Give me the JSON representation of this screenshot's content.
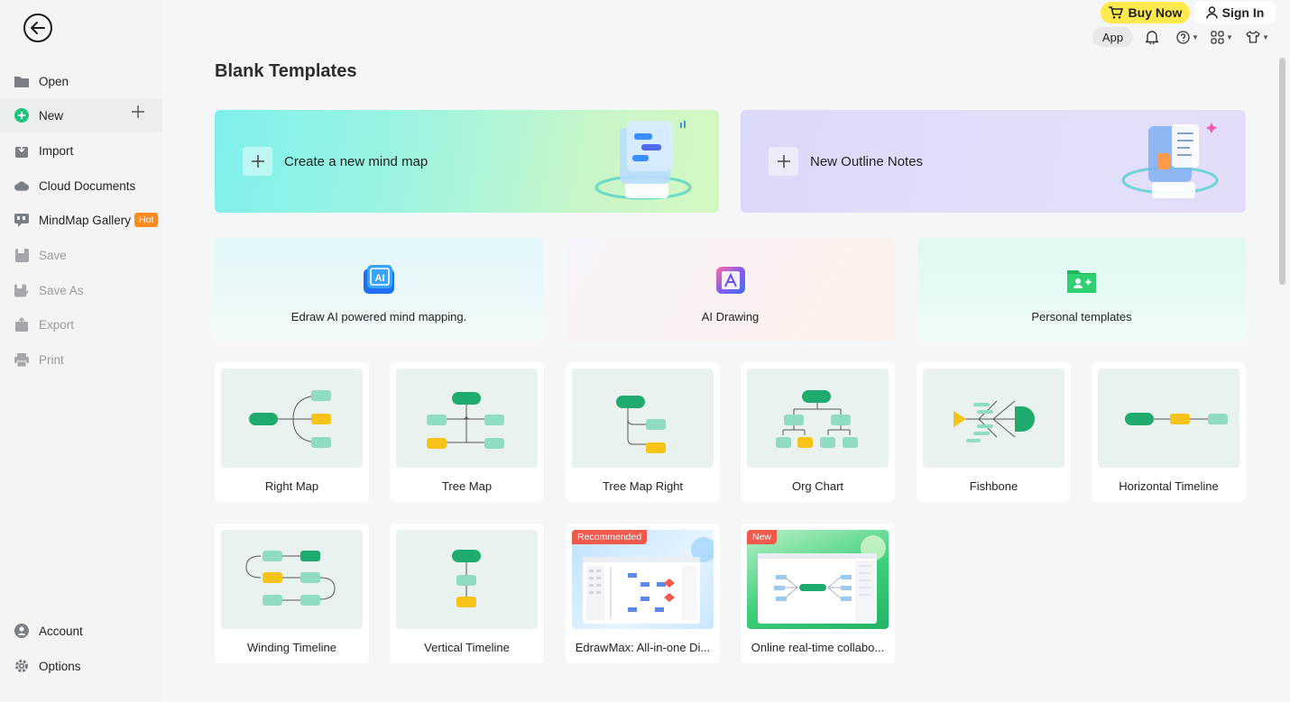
{
  "sidebar": {
    "items": [
      {
        "label": "Open",
        "icon": "folder-icon"
      },
      {
        "label": "New",
        "icon": "plus-circle-icon"
      },
      {
        "label": "Import",
        "icon": "import-icon"
      },
      {
        "label": "Cloud Documents",
        "icon": "cloud-icon"
      },
      {
        "label": "MindMap Gallery",
        "icon": "gallery-icon",
        "badge": "Hot"
      },
      {
        "label": "Save",
        "icon": "save-icon"
      },
      {
        "label": "Save As",
        "icon": "save-as-icon"
      },
      {
        "label": "Export",
        "icon": "export-icon"
      },
      {
        "label": "Print",
        "icon": "print-icon"
      }
    ],
    "bottom": [
      {
        "label": "Account",
        "icon": "account-icon"
      },
      {
        "label": "Options",
        "icon": "gear-icon"
      }
    ]
  },
  "topbar": {
    "buy_now": "Buy Now",
    "sign_in": "Sign In",
    "app": "App"
  },
  "main": {
    "title": "Blank Templates",
    "hero": [
      {
        "label": "Create a new mind map"
      },
      {
        "label": "New Outline Notes"
      }
    ],
    "features": [
      {
        "label": "Edraw AI powered mind mapping."
      },
      {
        "label": "AI Drawing"
      },
      {
        "label": "Personal templates"
      }
    ],
    "templates": [
      {
        "label": "Right Map"
      },
      {
        "label": "Tree Map"
      },
      {
        "label": "Tree Map Right"
      },
      {
        "label": "Org Chart"
      },
      {
        "label": "Fishbone"
      },
      {
        "label": "Horizontal Timeline"
      },
      {
        "label": "Winding Timeline"
      },
      {
        "label": "Vertical Timeline"
      },
      {
        "label": "EdrawMax: All-in-one Di...",
        "badge": "Recommended"
      },
      {
        "label": "Online real-time collabo...",
        "badge": "New"
      }
    ]
  },
  "colors": {
    "green": "#1fab6d",
    "mint": "#8fdcc3",
    "yellow": "#f7c317",
    "hot": "#ff8a1f",
    "recommended": "#ef5a4d",
    "new_badge": "#ef5a4d"
  }
}
